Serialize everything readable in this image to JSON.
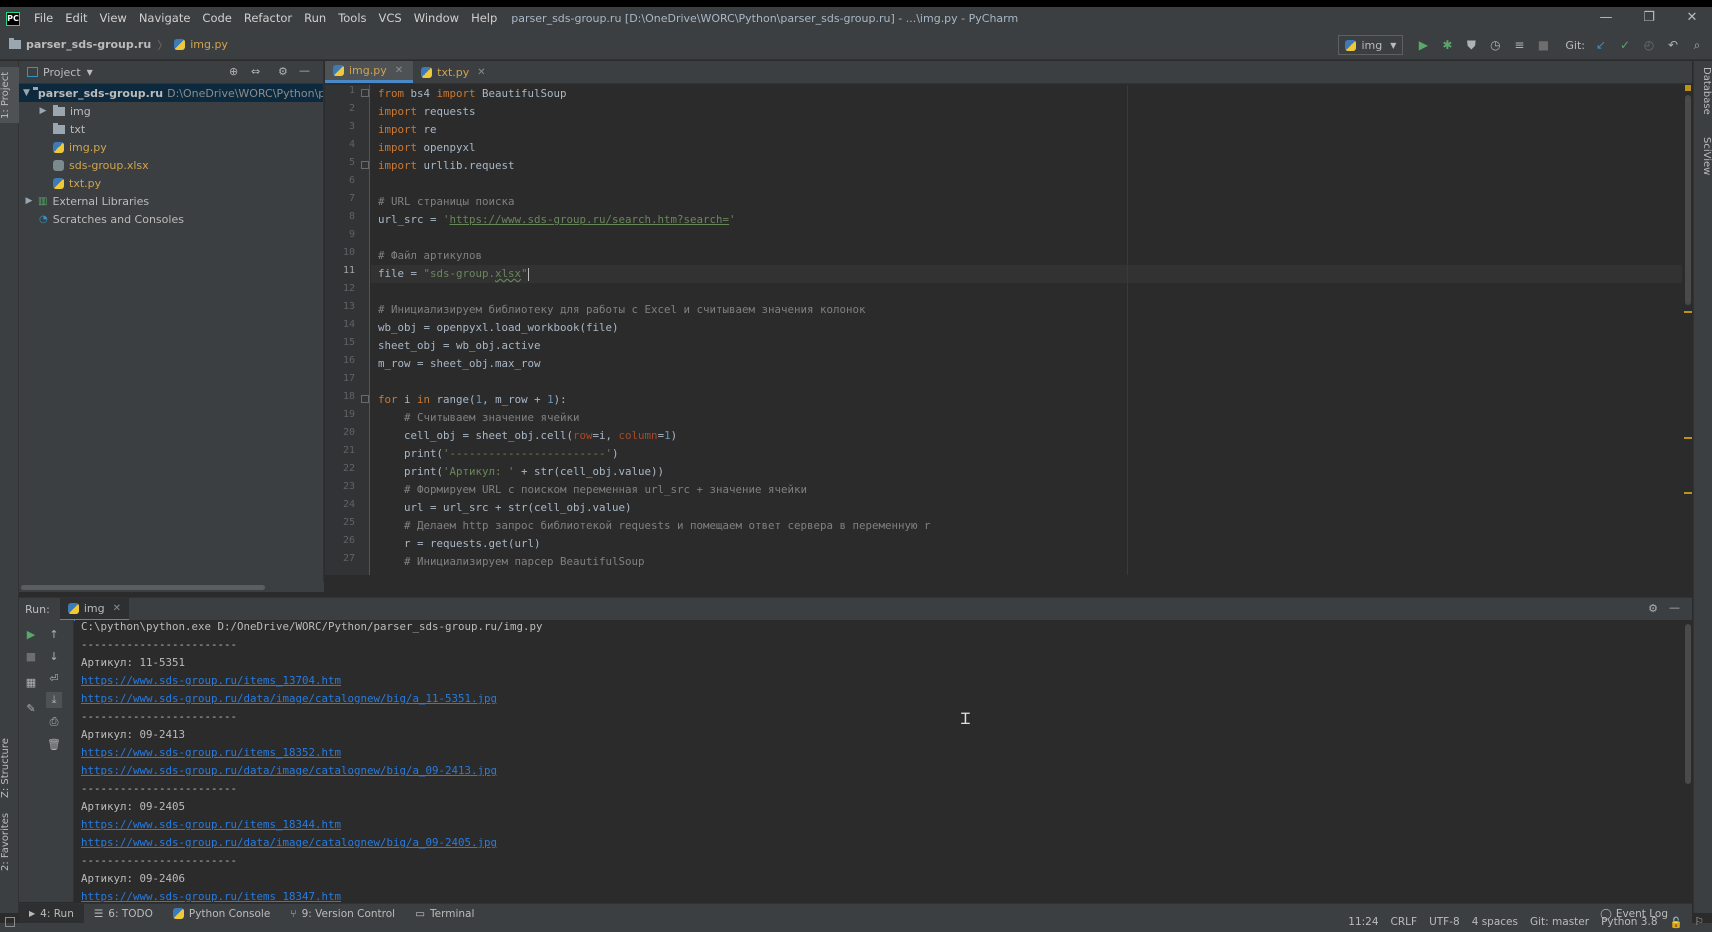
{
  "window": {
    "title": "parser_sds-group.ru [D:\\OneDrive\\WORC\\Python\\parser_sds-group.ru] - ...\\img.py - PyCharm",
    "logo": "PC",
    "menu": [
      "File",
      "Edit",
      "View",
      "Navigate",
      "Code",
      "Refactor",
      "Run",
      "Tools",
      "VCS",
      "Window",
      "Help"
    ],
    "minimize": "—",
    "restore": "❐",
    "close": "✕"
  },
  "navbar": {
    "project": "parser_sds-group.ru",
    "file": "img.py",
    "run_config": "img",
    "git_label": "Git:"
  },
  "left_strip": {
    "project_tab": "1: Project",
    "structure_tab": "Z: Structure",
    "favorites_tab": "2: Favorites"
  },
  "right_strip": {
    "database_tab": "Database",
    "sciview_tab": "SciView"
  },
  "project": {
    "header": "Project",
    "root_name": "parser_sds-group.ru",
    "root_path": "D:\\OneDrive\\WORC\\Python\\parser",
    "items": [
      {
        "label": "img",
        "color": "#bbbbbb"
      },
      {
        "label": "txt",
        "color": "#bbbbbb"
      },
      {
        "label": "img.py",
        "color": "#d0a34f"
      },
      {
        "label": "sds-group.xlsx",
        "color": "#d0a34f"
      },
      {
        "label": "txt.py",
        "color": "#d0a34f"
      }
    ],
    "external": "External Libraries",
    "scratches": "Scratches and Consoles"
  },
  "editor": {
    "tabs": [
      "img.py",
      "txt.py"
    ],
    "current_line": 11,
    "line_numbers": [
      "1",
      "2",
      "3",
      "4",
      "5",
      "6",
      "7",
      "8",
      "9",
      "10",
      "11",
      "12",
      "13",
      "14",
      "15",
      "16",
      "17",
      "18",
      "19",
      "20",
      "21",
      "22",
      "23",
      "24",
      "25",
      "26",
      "27"
    ],
    "code": {
      "l1_kw1": "from",
      "l1_mod": " bs4 ",
      "l1_kw2": "import",
      "l1_name": " BeautifulSoup",
      "l2_kw": "import",
      "l2_mod": " requests",
      "l3_kw": "import",
      "l3_mod": " re",
      "l4_kw": "import",
      "l4_mod": " openpyxl",
      "l5_kw": "import",
      "l5_mod": " urllib.request",
      "l7": "# URL страницы поиска",
      "l8_a": "url_src = ",
      "l8_q1": "'",
      "l8_url": "https://www.sds-group.ru/search.htm?search=",
      "l8_q2": "'",
      "l10": "# Файл артикулов",
      "l11_a": "file = ",
      "l11_s": "\"sds-group.",
      "l11_ext": "xlsx",
      "l11_q": "\"",
      "l13": "# Инициализируем библиотеку для работы с Excel и считываем значения колонок",
      "l14": "wb_obj = openpyxl.load_workbook(file)",
      "l15": "sheet_obj = wb_obj.active",
      "l16": "m_row = sheet_obj.max_row",
      "l18_kw1": "for",
      "l18_a": " i ",
      "l18_kw2": "in",
      "l18_b": " range(",
      "l18_n1": "1",
      "l18_c": ", m_row + ",
      "l18_n2": "1",
      "l18_d": "):",
      "l19": "    # Считываем значение ячейки",
      "l20_a": "    cell_obj = sheet_obj.cell(",
      "l20_p1": "row",
      "l20_b": "=i, ",
      "l20_p2": "column",
      "l20_c": "=",
      "l20_n": "1",
      "l20_d": ")",
      "l21_a": "    print(",
      "l21_s": "'------------------------'",
      "l21_b": ")",
      "l22_a": "    print(",
      "l22_s": "'Артикул: '",
      "l22_b": " + str(cell_obj.value))",
      "l23": "    # Формируем URL с поиском переменная url_src + значение ячейки",
      "l24": "    url = url_src + str(cell_obj.value)",
      "l25": "    # Делаем http запрос библиотекой requests и помещаем ответ сервера в переменную r",
      "l26": "    r = requests.get(url)",
      "l27": "    # Инициализируем парсер BeautifulSoup"
    }
  },
  "run": {
    "label": "Run:",
    "tab": "img",
    "lines": [
      {
        "text": "C:\\python\\python.exe D:/OneDrive/WORC/Python/parser_sds-group.ru/img.py",
        "link": false
      },
      {
        "text": "------------------------",
        "link": false
      },
      {
        "text": "Артикул: 11-5351",
        "link": false
      },
      {
        "text": "https://www.sds-group.ru/items_13704.htm",
        "link": true
      },
      {
        "text": "https://www.sds-group.ru/data/image/catalognew/big/a_11-5351.jpg",
        "link": true
      },
      {
        "text": "------------------------",
        "link": false
      },
      {
        "text": "Артикул: 09-2413",
        "link": false
      },
      {
        "text": "https://www.sds-group.ru/items_18352.htm",
        "link": true
      },
      {
        "text": "https://www.sds-group.ru/data/image/catalognew/big/a_09-2413.jpg",
        "link": true
      },
      {
        "text": "------------------------",
        "link": false
      },
      {
        "text": "Артикул: 09-2405",
        "link": false
      },
      {
        "text": "https://www.sds-group.ru/items_18344.htm",
        "link": true
      },
      {
        "text": "https://www.sds-group.ru/data/image/catalognew/big/a_09-2405.jpg",
        "link": true
      },
      {
        "text": "------------------------",
        "link": false
      },
      {
        "text": "Артикул: 09-2406",
        "link": false
      },
      {
        "text": "https://www.sds-group.ru/items_18347.htm",
        "link": true
      }
    ]
  },
  "tool_tabs": {
    "run": "4: Run",
    "todo": "6: TODO",
    "python_console": "Python Console",
    "version_control": "9: Version Control",
    "terminal": "Terminal",
    "event_log": "Event Log"
  },
  "status": {
    "position": "11:24",
    "line_sep": "CRLF",
    "encoding": "UTF-8",
    "indent": "4 spaces",
    "git": "Git: master",
    "interpreter": "Python 3.8"
  },
  "colors": {
    "accent": "#4a88c7",
    "link": "#287bde",
    "keyword": "#cc7832",
    "string": "#6a8759",
    "comment": "#808080"
  }
}
